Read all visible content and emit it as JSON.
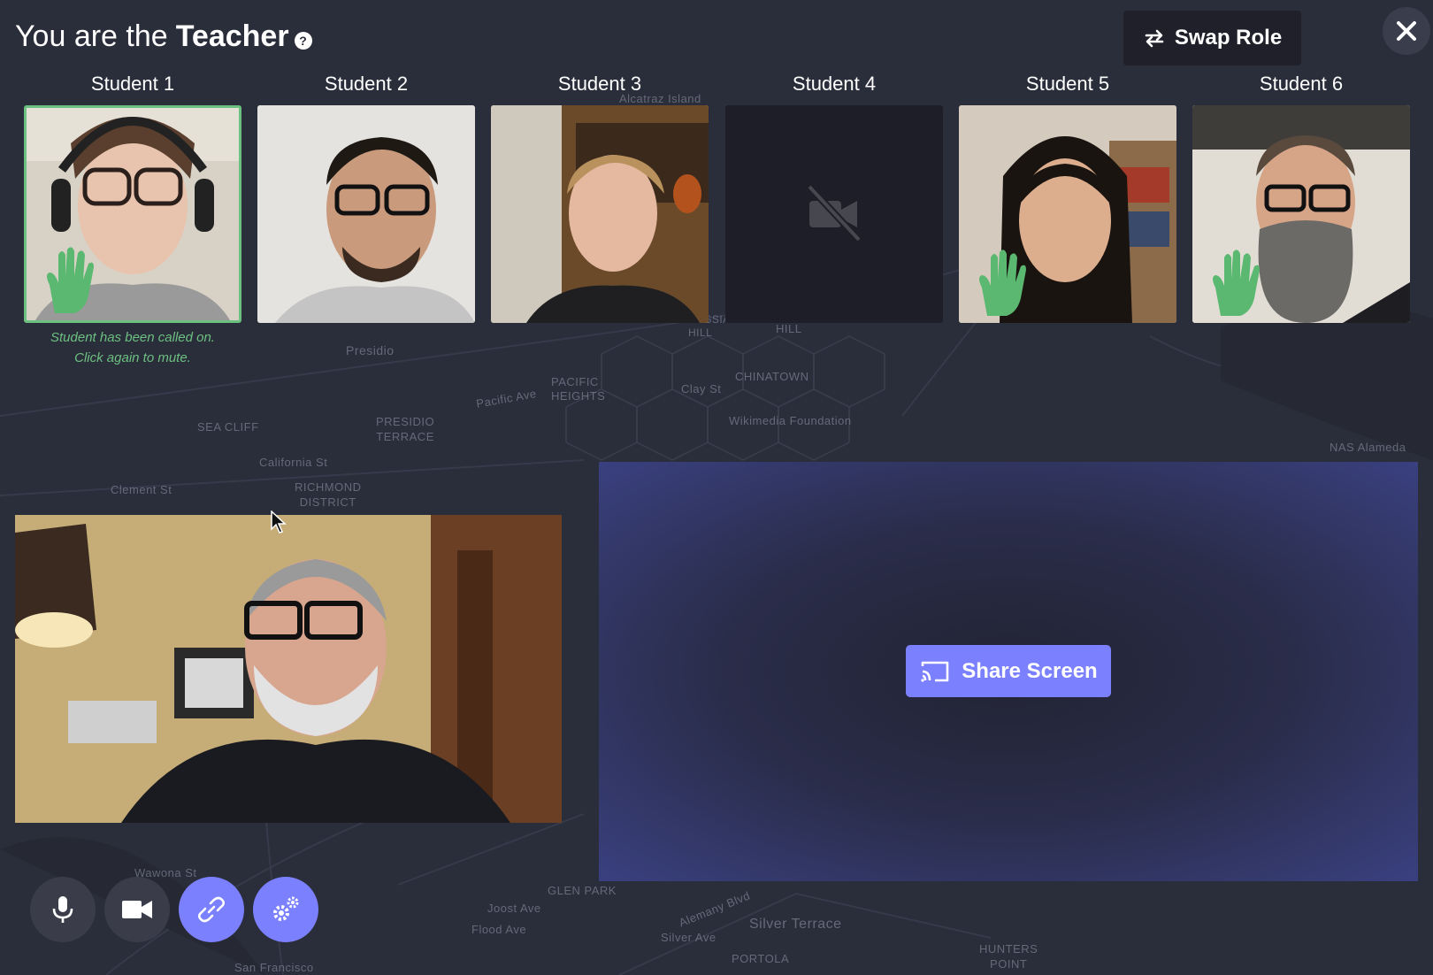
{
  "header": {
    "role_prefix": "You are the",
    "role_name": "Teacher",
    "help_glyph": "?",
    "swap_button_label": "Swap Role"
  },
  "students": [
    {
      "name": "Student 1",
      "video": "on",
      "hand_raised": true,
      "called_on": true
    },
    {
      "name": "Student 2",
      "video": "on",
      "hand_raised": false
    },
    {
      "name": "Student 3",
      "video": "on",
      "hand_raised": false
    },
    {
      "name": "Student 4",
      "video": "off",
      "hand_raised": false
    },
    {
      "name": "Student 5",
      "video": "on",
      "hand_raised": true
    },
    {
      "name": "Student 6",
      "video": "on",
      "hand_raised": true
    }
  ],
  "called_on_note": {
    "line1": "Student has been called on.",
    "line2": "Click again to mute."
  },
  "share": {
    "button_label": "Share Screen"
  },
  "controls": [
    {
      "icon": "microphone-icon",
      "style": "dark"
    },
    {
      "icon": "video-camera-icon",
      "style": "dark"
    },
    {
      "icon": "link-icon",
      "style": "accent"
    },
    {
      "icon": "settings-icon",
      "style": "accent"
    }
  ],
  "map_labels": {
    "alcatraz": "Alcatraz Island",
    "presidio": "Presidio",
    "pacific_heights": "PACIFIC\nHEIGHTS",
    "sea_cliff": "SEA CLIFF",
    "presidio_terrace": "PRESIDIO\nTERRACE",
    "california_st": "California St",
    "richmond": "RICHMOND\nDISTRICT",
    "clement": "Clement St",
    "pacific_ave": "Pacific Ave",
    "clay_st": "Clay St",
    "chinatown": "CHINATOWN",
    "wikimedia": "Wikimedia Foundation",
    "nas_alameda": "NAS Alameda",
    "glen_park": "GLEN PARK",
    "silver_terrace": "Silver Terrace",
    "portola": "PORTOLA",
    "hunters_point": "HUNTERS\nPOINT",
    "wawona": "Wawona St",
    "joost": "Joost Ave",
    "flood": "Flood Ave",
    "silver_ave": "Silver Ave",
    "alemany": "Alemany Blvd",
    "san_francisco": "San Francisco",
    "hill": "HILL",
    "russian_hill": "RUSSIAN\nHILL"
  },
  "colors": {
    "background": "#2a2d3a",
    "accent": "#7b80ff",
    "called_green": "#6cc080",
    "hand_green": "#5bb870"
  }
}
